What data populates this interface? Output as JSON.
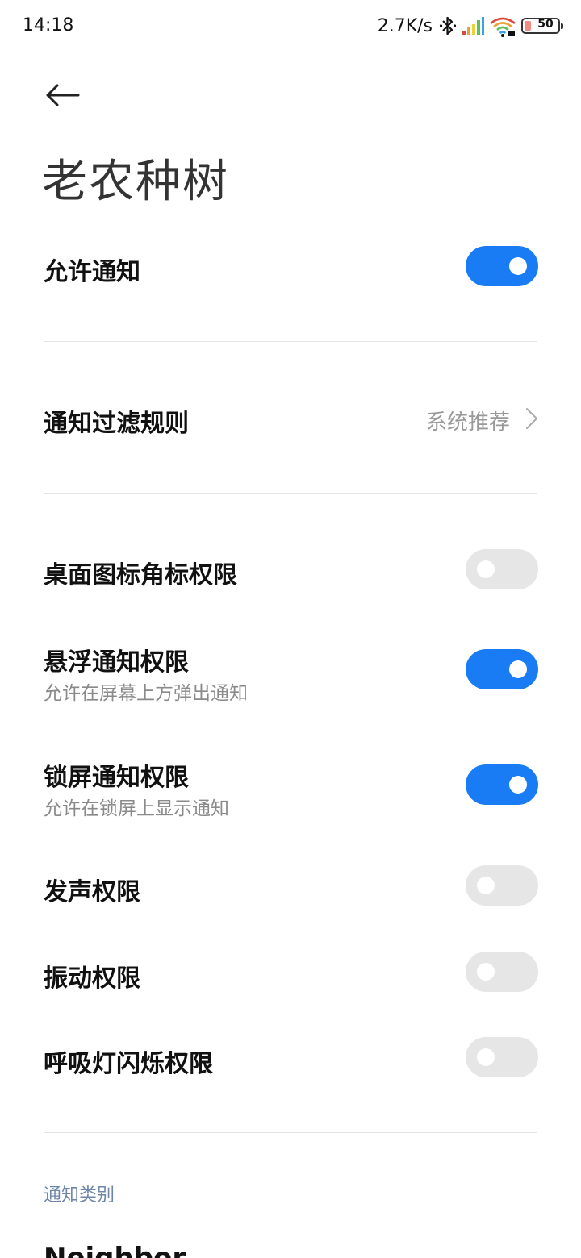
{
  "status_bar": {
    "time": "14:18",
    "net_speed": "2.7K/s",
    "battery": "50",
    "icons": [
      "bluetooth-icon",
      "signal-icon",
      "wifi-icon",
      "battery-icon"
    ]
  },
  "header": {
    "back_icon": "arrow-left-icon",
    "title": "老农种树"
  },
  "settings": {
    "allow_notifications": {
      "label": "允许通知",
      "on": true
    },
    "filter_rules": {
      "label": "通知过滤规则",
      "value": "系统推荐"
    },
    "badge": {
      "label": "桌面图标角标权限",
      "on": false
    },
    "floating": {
      "label": "悬浮通知权限",
      "sub": "允许在屏幕上方弹出通知",
      "on": true
    },
    "lockscreen": {
      "label": "锁屏通知权限",
      "sub": "允许在锁屏上显示通知",
      "on": true
    },
    "sound": {
      "label": "发声权限",
      "on": false
    },
    "vibration": {
      "label": "振动权限",
      "on": false
    },
    "breathing_light": {
      "label": "呼吸灯闪烁权限",
      "on": false
    }
  },
  "categories": {
    "header": "通知类别",
    "items": [
      "Neighbor"
    ]
  },
  "colors": {
    "accent": "#1a7cf5",
    "toggle_off": "#e6e6e6",
    "section_header": "#6e86a8"
  }
}
